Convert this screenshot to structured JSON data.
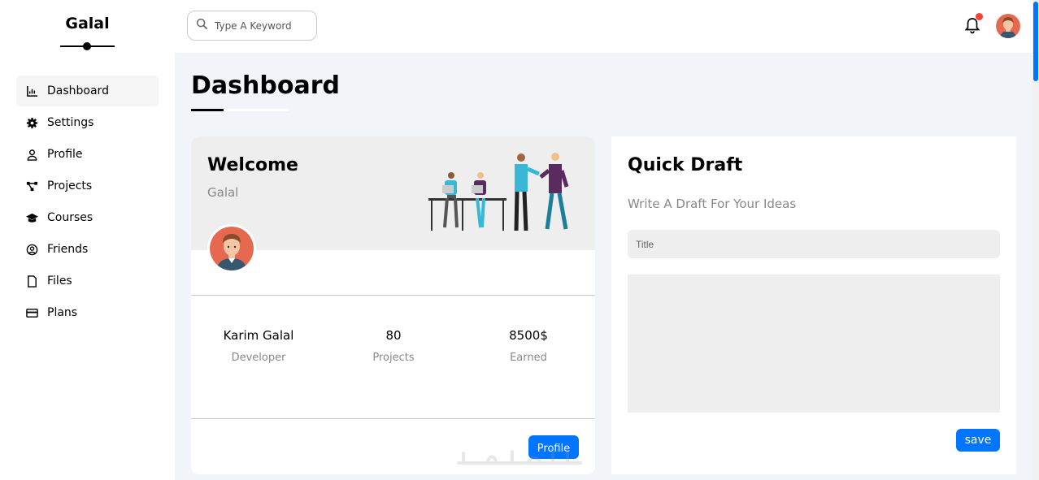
{
  "brand": {
    "name": "Galal"
  },
  "sidebar": {
    "items": [
      {
        "label": "Dashboard",
        "icon": "chart-icon",
        "active": true
      },
      {
        "label": "Settings",
        "icon": "gear-icon",
        "active": false
      },
      {
        "label": "Profile",
        "icon": "user-icon",
        "active": false
      },
      {
        "label": "Projects",
        "icon": "diagram-icon",
        "active": false
      },
      {
        "label": "Courses",
        "icon": "graduation-cap-icon",
        "active": false
      },
      {
        "label": "Friends",
        "icon": "user-circle-icon",
        "active": false
      },
      {
        "label": "Files",
        "icon": "file-icon",
        "active": false
      },
      {
        "label": "Plans",
        "icon": "credit-card-icon",
        "active": false
      }
    ]
  },
  "header": {
    "search": {
      "placeholder": "Type A Keyword",
      "icon": "search-icon"
    },
    "notification_icon": "bell-icon",
    "badge_color": "#f44336"
  },
  "page": {
    "title": "Dashboard"
  },
  "welcome": {
    "heading": "Welcome",
    "name": "Galal",
    "stats": [
      {
        "value": "Karim Galal",
        "label": "Developer"
      },
      {
        "value": "80",
        "label": "Projects"
      },
      {
        "value": "8500$",
        "label": "Earned"
      }
    ],
    "button_label": "Profile"
  },
  "draft": {
    "heading": "Quick Draft",
    "subtitle": "Write A Draft For Your Ideas",
    "title_placeholder": "Title",
    "button_label": "save"
  },
  "colors": {
    "accent": "#0075ff",
    "background": "#f1f5f9",
    "muted": "#888888"
  }
}
